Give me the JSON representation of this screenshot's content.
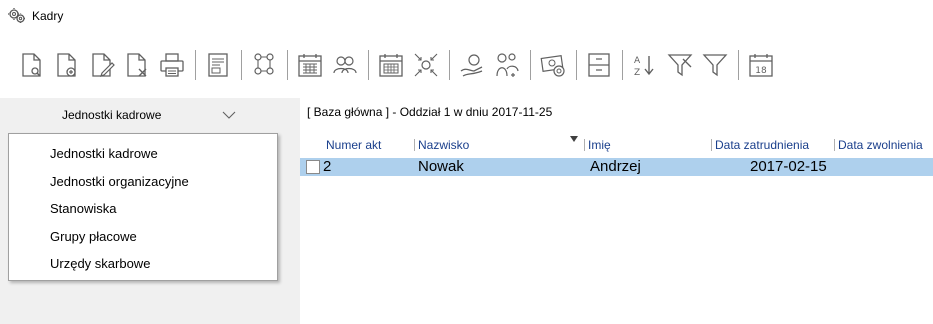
{
  "window": {
    "title": "Kadry",
    "app_icon": "gears-icon"
  },
  "toolbar": {
    "groups": [
      [
        "preview-document-icon",
        "new-document-icon",
        "edit-document-icon",
        "delete-document-icon",
        "print-icon"
      ],
      [
        "report-icon"
      ],
      [
        "org-structure-icon"
      ],
      [
        "calendar-grid-icon",
        "people-icon"
      ],
      [
        "schedule-icon",
        "compress-icon"
      ],
      [
        "hand-money-icon",
        "medical-icon"
      ],
      [
        "payroll-icon"
      ],
      [
        "cabinet-icon"
      ],
      [
        "sort-az-icon",
        "filter-clear-icon",
        "filter-icon"
      ],
      [
        "calendar-day-icon"
      ]
    ],
    "calendar_day": "18"
  },
  "left_panel": {
    "selector_label": "Jednostki kadrowe",
    "dropdown_items": [
      "Jednostki kadrowe",
      "Jednostki organizacyjne",
      "Stanowiska",
      "Grupy płacowe",
      "Urzędy skarbowe"
    ]
  },
  "context_label": "[ Baza główna ] - Oddział 1  w dniu 2017-11-25",
  "grid": {
    "columns": [
      "Numer akt",
      "Nazwisko",
      "Imię",
      "Data zatrudnienia",
      "Data zwolnienia"
    ],
    "sorted_column": "Nazwisko",
    "rows": [
      {
        "numer_akt": "2",
        "nazwisko": "Nowak",
        "imie": "Andrzej",
        "data_zatrudnienia": "2017-02-15",
        "data_zwolnienia": "",
        "selected": true,
        "checked": false
      }
    ]
  },
  "colors": {
    "selected_row": "#aed0ed",
    "header_text": "#1a3f8c",
    "panel_bg": "#f0f0f0",
    "icon_stroke": "#606060"
  }
}
